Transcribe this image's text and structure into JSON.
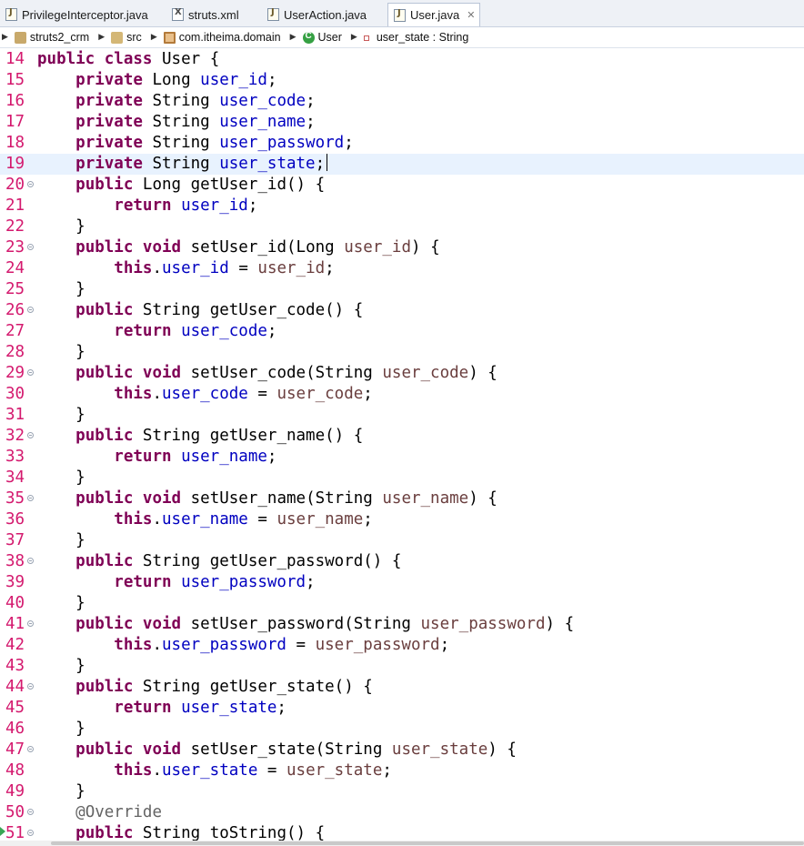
{
  "tabs": [
    {
      "label": "PrivilegeInterceptor.java",
      "icon": "java-file-icon",
      "active": false
    },
    {
      "label": "struts.xml",
      "icon": "xml-file-icon",
      "active": false
    },
    {
      "label": "UserAction.java",
      "icon": "java-file-icon",
      "active": false
    },
    {
      "label": "User.java",
      "icon": "java-file-icon",
      "active": true,
      "close": "✕"
    }
  ],
  "breadcrumb": [
    {
      "label": "struts2_crm",
      "icon": "project-icon"
    },
    {
      "label": "src",
      "icon": "source-folder-icon"
    },
    {
      "label": "com.itheima.domain",
      "icon": "package-icon"
    },
    {
      "label": "User",
      "icon": "class-icon"
    },
    {
      "label": "user_state : String",
      "icon": "field-icon"
    }
  ],
  "editor": {
    "current_line": 19,
    "lines": [
      {
        "n": "14",
        "code": "public class User {"
      },
      {
        "n": "15",
        "code": "    private Long user_id;"
      },
      {
        "n": "16",
        "code": "    private String user_code;"
      },
      {
        "n": "17",
        "code": "    private String user_name;"
      },
      {
        "n": "18",
        "code": "    private String user_password;"
      },
      {
        "n": "19",
        "code": "    private String user_state;"
      },
      {
        "n": "20",
        "code": "    public Long getUser_id() {"
      },
      {
        "n": "21",
        "code": "        return user_id;"
      },
      {
        "n": "22",
        "code": "    }"
      },
      {
        "n": "23",
        "code": "    public void setUser_id(Long user_id) {"
      },
      {
        "n": "24",
        "code": "        this.user_id = user_id;"
      },
      {
        "n": "25",
        "code": "    }"
      },
      {
        "n": "26",
        "code": "    public String getUser_code() {"
      },
      {
        "n": "27",
        "code": "        return user_code;"
      },
      {
        "n": "28",
        "code": "    }"
      },
      {
        "n": "29",
        "code": "    public void setUser_code(String user_code) {"
      },
      {
        "n": "30",
        "code": "        this.user_code = user_code;"
      },
      {
        "n": "31",
        "code": "    }"
      },
      {
        "n": "32",
        "code": "    public String getUser_name() {"
      },
      {
        "n": "33",
        "code": "        return user_name;"
      },
      {
        "n": "34",
        "code": "    }"
      },
      {
        "n": "35",
        "code": "    public void setUser_name(String user_name) {"
      },
      {
        "n": "36",
        "code": "        this.user_name = user_name;"
      },
      {
        "n": "37",
        "code": "    }"
      },
      {
        "n": "38",
        "code": "    public String getUser_password() {"
      },
      {
        "n": "39",
        "code": "        return user_password;"
      },
      {
        "n": "40",
        "code": "    }"
      },
      {
        "n": "41",
        "code": "    public void setUser_password(String user_password) {"
      },
      {
        "n": "42",
        "code": "        this.user_password = user_password;"
      },
      {
        "n": "43",
        "code": "    }"
      },
      {
        "n": "44",
        "code": "    public String getUser_state() {"
      },
      {
        "n": "45",
        "code": "        return user_state;"
      },
      {
        "n": "46",
        "code": "    }"
      },
      {
        "n": "47",
        "code": "    public void setUser_state(String user_state) {"
      },
      {
        "n": "48",
        "code": "        this.user_state = user_state;"
      },
      {
        "n": "49",
        "code": "    }"
      },
      {
        "n": "50",
        "code": "    @Override"
      },
      {
        "n": "51",
        "code": "    public String toString() {"
      }
    ]
  }
}
